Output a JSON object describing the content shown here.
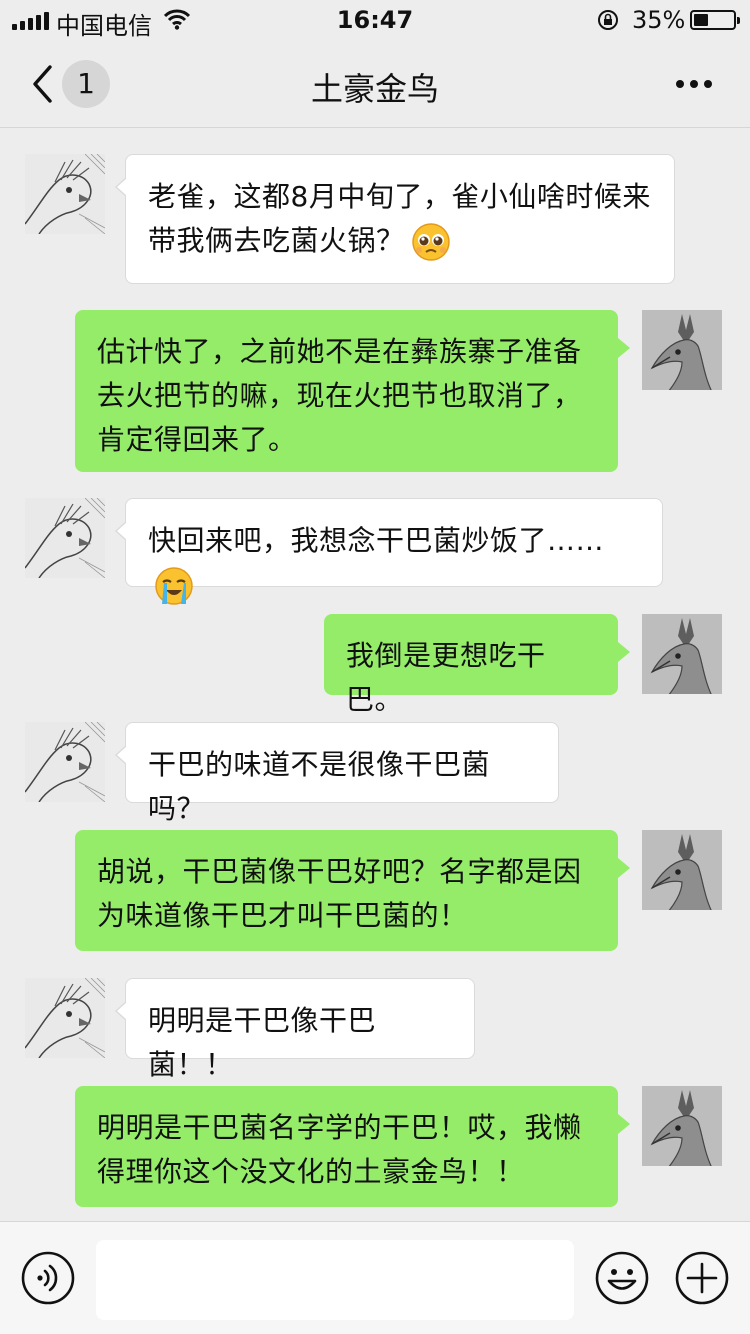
{
  "status_bar": {
    "carrier": "中国电信",
    "time": "16:47",
    "battery": "35%"
  },
  "header": {
    "back_badge": "1",
    "title": "土豪金鸟"
  },
  "messages": [
    {
      "side": "left",
      "text": "老雀，这都8月中旬了，雀小仙啥时候来带我俩去吃菌火锅？",
      "emoji": "pleading-face"
    },
    {
      "side": "right",
      "text": "估计快了，之前她不是在彝族寨子准备去火把节的嘛，现在火把节也取消了，肯定得回来了。"
    },
    {
      "side": "left",
      "text": "快回来吧，我想念干巴菌炒饭了……",
      "emoji": "crying-face"
    },
    {
      "side": "right",
      "text": "我倒是更想吃干巴。"
    },
    {
      "side": "left",
      "text": "干巴的味道不是很像干巴菌吗？"
    },
    {
      "side": "right",
      "text": "胡说，干巴菌像干巴好吧？名字都是因为味道像干巴才叫干巴菌的！"
    },
    {
      "side": "left",
      "text": "明明是干巴像干巴菌！！"
    },
    {
      "side": "right",
      "text": "明明是干巴菌名字学的干巴！哎，我懒得理你这个没文化的土豪金鸟！！"
    }
  ],
  "input_bar": {
    "placeholder": ""
  },
  "colors": {
    "background": "#ededed",
    "bubble_self": "#95ec69",
    "bubble_other": "#ffffff"
  }
}
